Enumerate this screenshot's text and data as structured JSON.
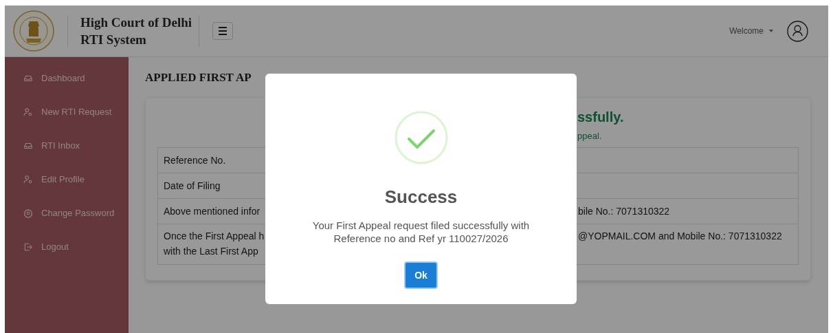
{
  "header": {
    "title_lines": [
      "High Court of Delhi",
      "RTI System"
    ],
    "user_menu": {
      "label": "Welcome"
    }
  },
  "sidebar": {
    "items": [
      {
        "label": "Dashboard",
        "kind": "inbox"
      },
      {
        "label": "New RTI Request",
        "kind": "user"
      },
      {
        "label": "RTI Inbox",
        "kind": "inbox"
      },
      {
        "label": "Edit Profile",
        "kind": "user"
      },
      {
        "label": "Change Password",
        "kind": "gear"
      },
      {
        "label": "Logout",
        "kind": "logout"
      }
    ]
  },
  "page": {
    "title": "APPLIED FIRST AP",
    "card": {
      "heading": "ssfully.",
      "subheading": "ppeal.",
      "rows": [
        {
          "left": [
            "Reference No."
          ]
        },
        {
          "left": [
            "Date of Filing"
          ]
        },
        {
          "left": [
            "Above mentioned infor"
          ],
          "right": [
            "bile No.: 7071310322"
          ]
        },
        {
          "left": [
            "Once the First Appeal h",
            "with the Last First App"
          ],
          "right": [
            "@YOPMAIL.COM and Mobile No.: 7071310322"
          ]
        }
      ]
    }
  },
  "dialog": {
    "open": true,
    "kind": "success",
    "title": "Success",
    "message_lines": [
      "Your First Appeal request filed successfully with",
      "Reference no and Ref yr 110027/2026"
    ],
    "button": "Ok"
  }
}
